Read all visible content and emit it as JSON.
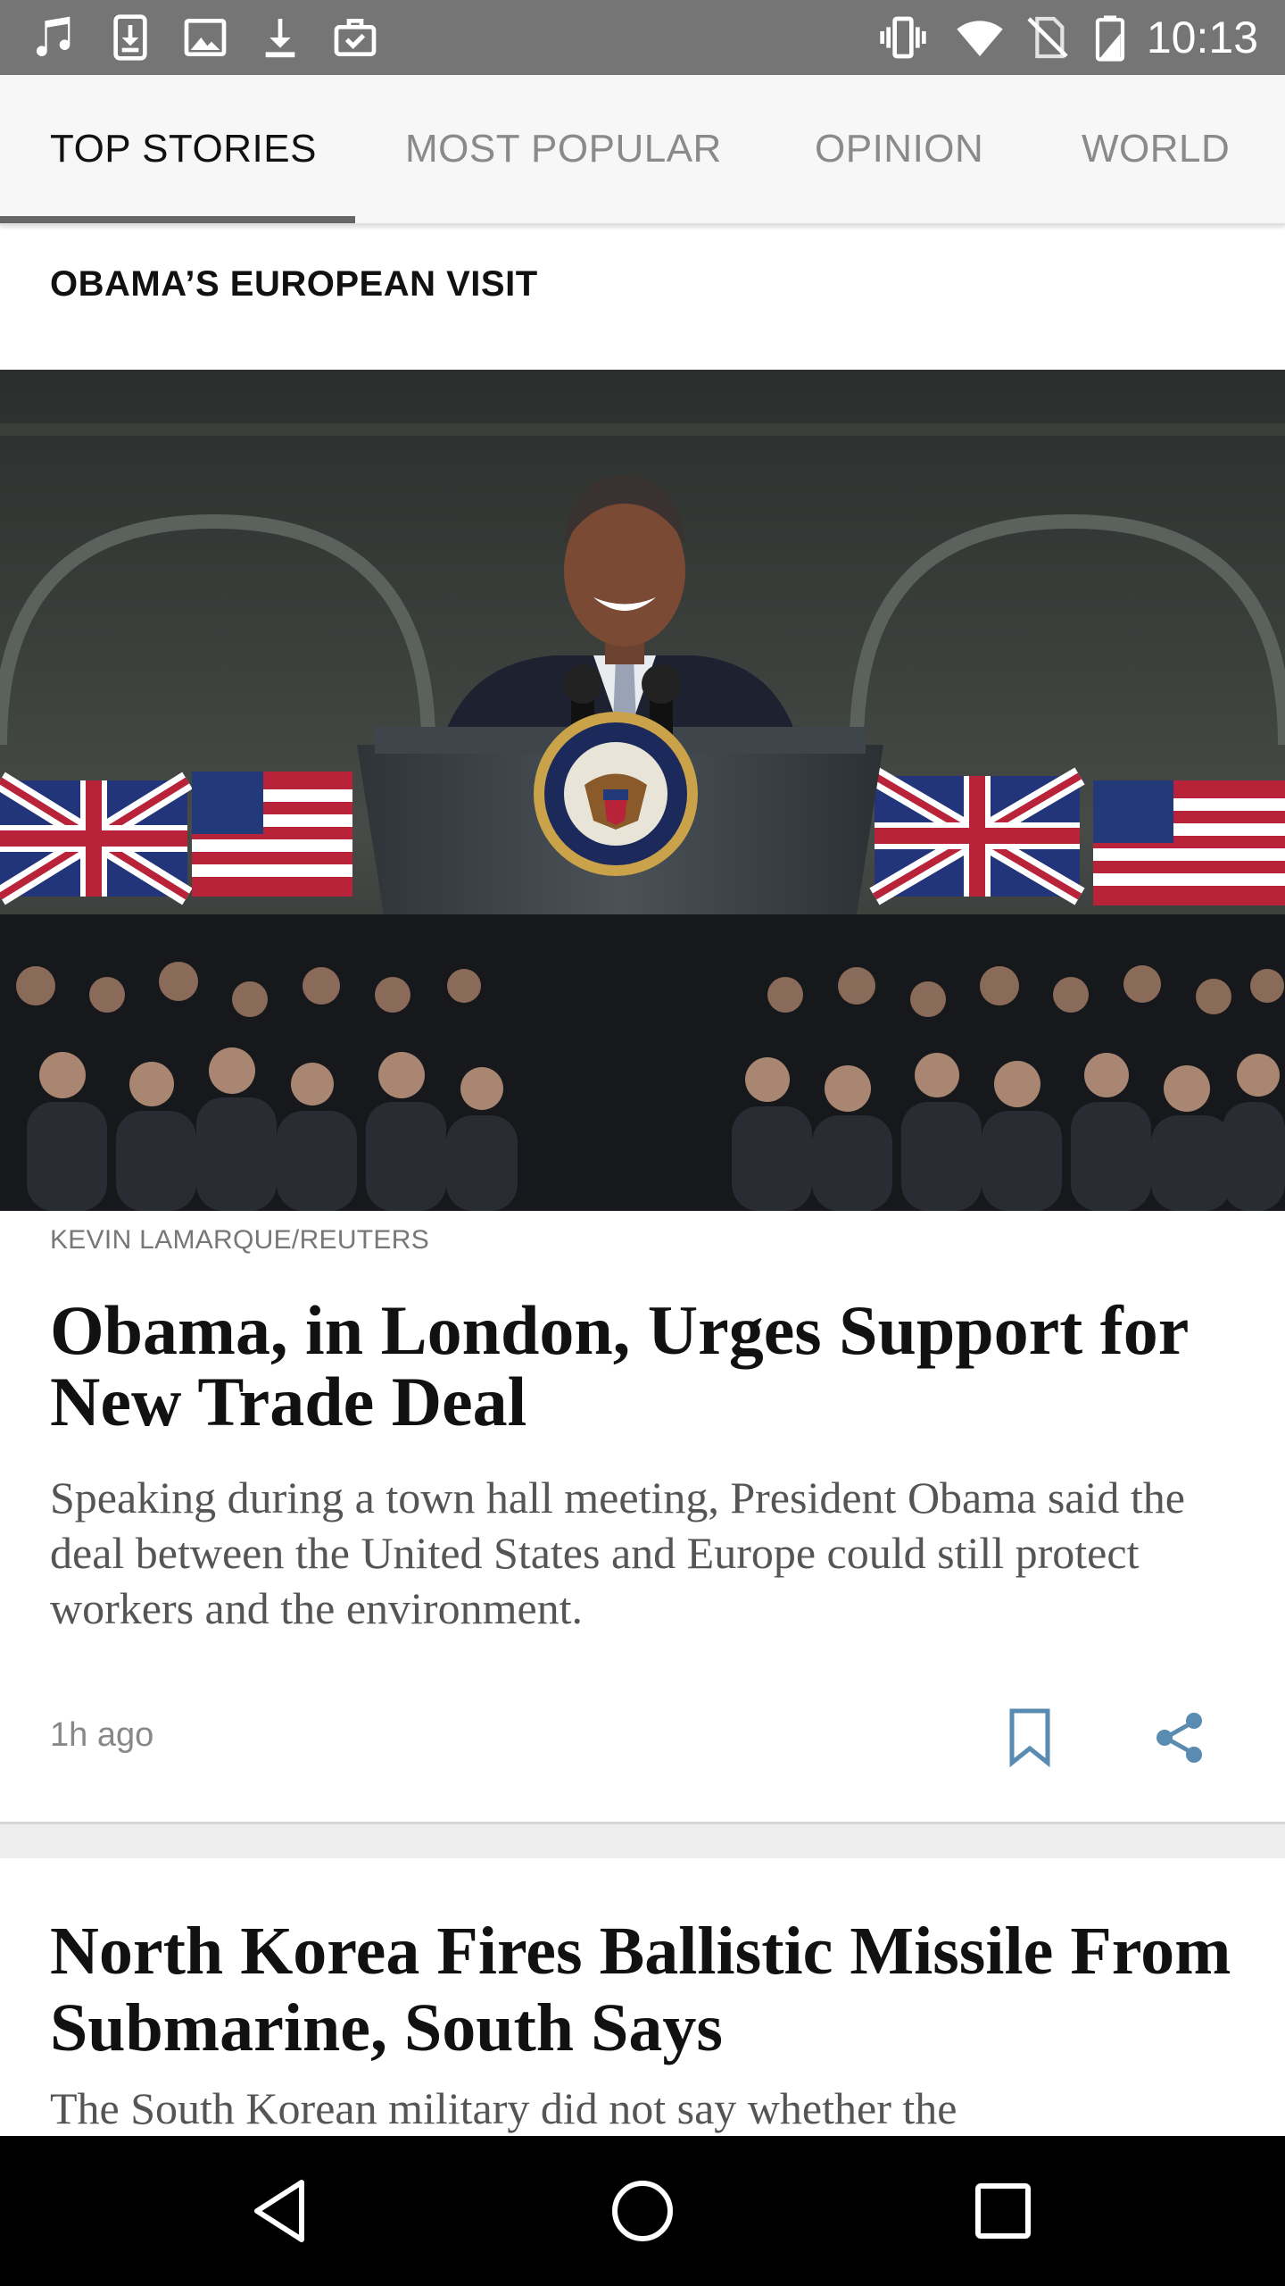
{
  "status_bar": {
    "icons": [
      "music-icon",
      "download-box-icon",
      "image-icon",
      "download-icon",
      "briefcase-check-icon",
      "vibrate-icon",
      "wifi-icon",
      "no-sim-icon",
      "battery-icon"
    ],
    "time": "10:13"
  },
  "tabs": [
    {
      "label": "TOP STORIES",
      "active": true
    },
    {
      "label": "MOST POPULAR",
      "active": false
    },
    {
      "label": "OPINION",
      "active": false
    },
    {
      "label": "WORLD",
      "active": false
    }
  ],
  "section": {
    "label": "OBAMA’S EUROPEAN VISIT"
  },
  "story1": {
    "image_description": "President at podium with seal, flags and audience",
    "credit": "KEVIN LAMARQUE/REUTERS",
    "headline": "Obama, in London, Urges Support for New Trade Deal",
    "summary": "Speaking during a town hall meeting, President Obama said the deal between the United States and Europe could still protect workers and the environment.",
    "timestamp": "1h ago",
    "actions": [
      "bookmark-icon",
      "share-icon"
    ],
    "accent_color": "#5a8bb0"
  },
  "story2": {
    "headline": "North Korea Fires Ballistic Missile From Submarine, South Says",
    "summary": "The South Korean military did not say whether the"
  },
  "nav_bar": {
    "buttons": [
      "back-icon",
      "home-icon",
      "recents-icon"
    ]
  }
}
